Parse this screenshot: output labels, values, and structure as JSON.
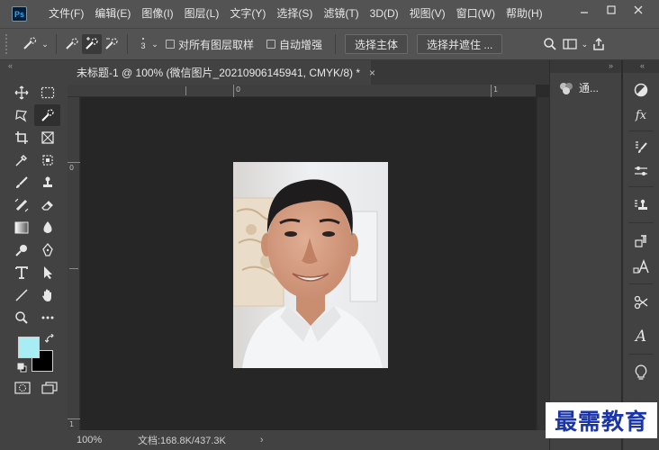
{
  "menubar": {
    "logo": "Ps",
    "items": [
      "文件(F)",
      "编辑(E)",
      "图像(I)",
      "图层(L)",
      "文字(Y)",
      "选择(S)",
      "滤镜(T)",
      "3D(D)",
      "视图(V)",
      "窗口(W)",
      "帮助(H)"
    ]
  },
  "options": {
    "brush_size": "3",
    "sample_all_layers": "对所有图层取样",
    "auto_enhance": "自动增强",
    "select_subject": "选择主体",
    "select_and_mask": "选择并遮住 ..."
  },
  "document": {
    "tab_title": "未标题-1 @ 100% (微信图片_20210906145941, CMYK/8) *",
    "close": "×"
  },
  "rulers": {
    "h_labels": [
      "0",
      "1"
    ],
    "v_labels": [
      "0",
      "1"
    ]
  },
  "status": {
    "zoom": "100%",
    "doc_info": "文档:168.8K/437.3K",
    "arrow": "›"
  },
  "panels": {
    "channels_label": "通..."
  },
  "colors": {
    "foreground": "#a8ecf4",
    "background": "#000000",
    "accent": "#31a8ff"
  },
  "watermark": "最需教育"
}
